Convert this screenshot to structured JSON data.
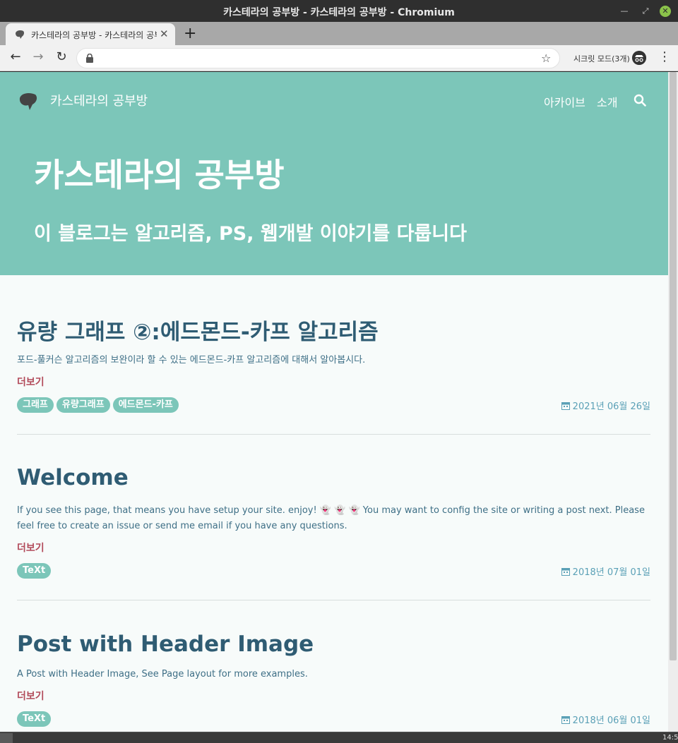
{
  "window": {
    "title": "카스테라의 공부방 - 카스테라의 공부방 - Chromium"
  },
  "tab": {
    "title": "카스테라의 공부방 - 카스테라의 공부방"
  },
  "toolbar": {
    "incognito_label": "시크릿 모드(3개)"
  },
  "site": {
    "name": "카스테라의 공부방",
    "nav": {
      "archive": "아카이브",
      "about": "소개"
    },
    "hero_title": "카스테라의 공부방",
    "hero_subtitle": "이 블로그는 알고리즘, PS, 웹개발 이야기를 다룹니다",
    "header_color": "#7cc6b9"
  },
  "posts": [
    {
      "title": "유량 그래프 ②:에드몬드-카프 알고리즘",
      "excerpt": "포드-풀커슨 알고리즘의 보완이라 할 수 있는 에드몬드-카프 알고리즘에 대해서 알아봅시다.",
      "read_more": "더보기",
      "tags": [
        "그래프",
        "유량그래프",
        "에드몬드-카프"
      ],
      "date": "2021년 06월 26일"
    },
    {
      "title": "Welcome",
      "excerpt": "If you see this page, that means you have setup your site. enjoy! 👻 👻 👻 You may want to config the site or writing a post next. Please feel free to create an issue or send me email if you have any questions.",
      "read_more": "더보기",
      "tags": [
        "TeXt"
      ],
      "date": "2018년 07월 01일"
    },
    {
      "title": "Post with Header Image",
      "excerpt": "A Post with Header Image, See Page layout for more examples.",
      "read_more": "더보기",
      "tags": [
        "TeXt"
      ],
      "date": "2018년 06월 01일"
    }
  ],
  "taskbar": {
    "time": "14:5"
  }
}
